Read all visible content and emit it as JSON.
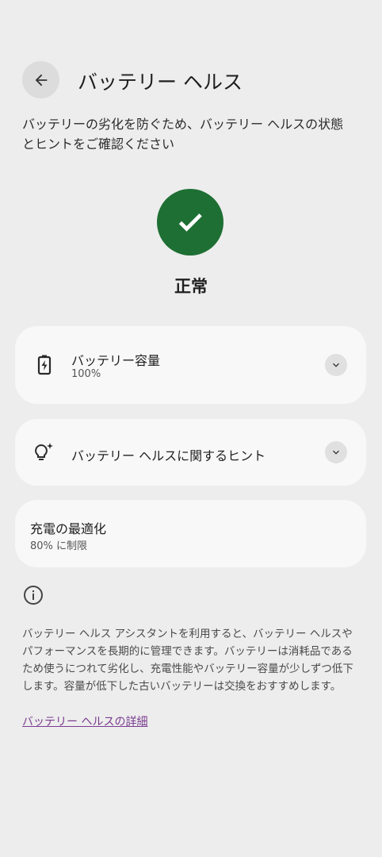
{
  "header": {
    "title": "バッテリー ヘルス",
    "back_icon": "arrow-back-icon"
  },
  "description": "バッテリーの劣化を防ぐため、バッテリー ヘルスの状態とヒントをご確認ください",
  "status": {
    "icon": "check-icon",
    "label": "正常",
    "color": "#1e6f34"
  },
  "cards": {
    "capacity": {
      "title": "バッテリー容量",
      "value": "100%",
      "icon": "battery-charging-icon"
    },
    "tips": {
      "title": "バッテリー ヘルスに関するヒント",
      "icon": "lightbulb-sparkle-icon"
    },
    "optimization": {
      "title": "充電の最適化",
      "value": "80% に制限"
    }
  },
  "info": {
    "icon": "info-icon",
    "text": "バッテリー ヘルス アシスタントを利用すると、バッテリー ヘルスやパフォーマンスを長期的に管理できます。バッテリーは消耗品であるため使うにつれて劣化し、充電性能やバッテリー容量が少しずつ低下します。容量が低下した古いバッテリーは交換をおすすめします。",
    "link": "バッテリー ヘルスの詳細"
  }
}
